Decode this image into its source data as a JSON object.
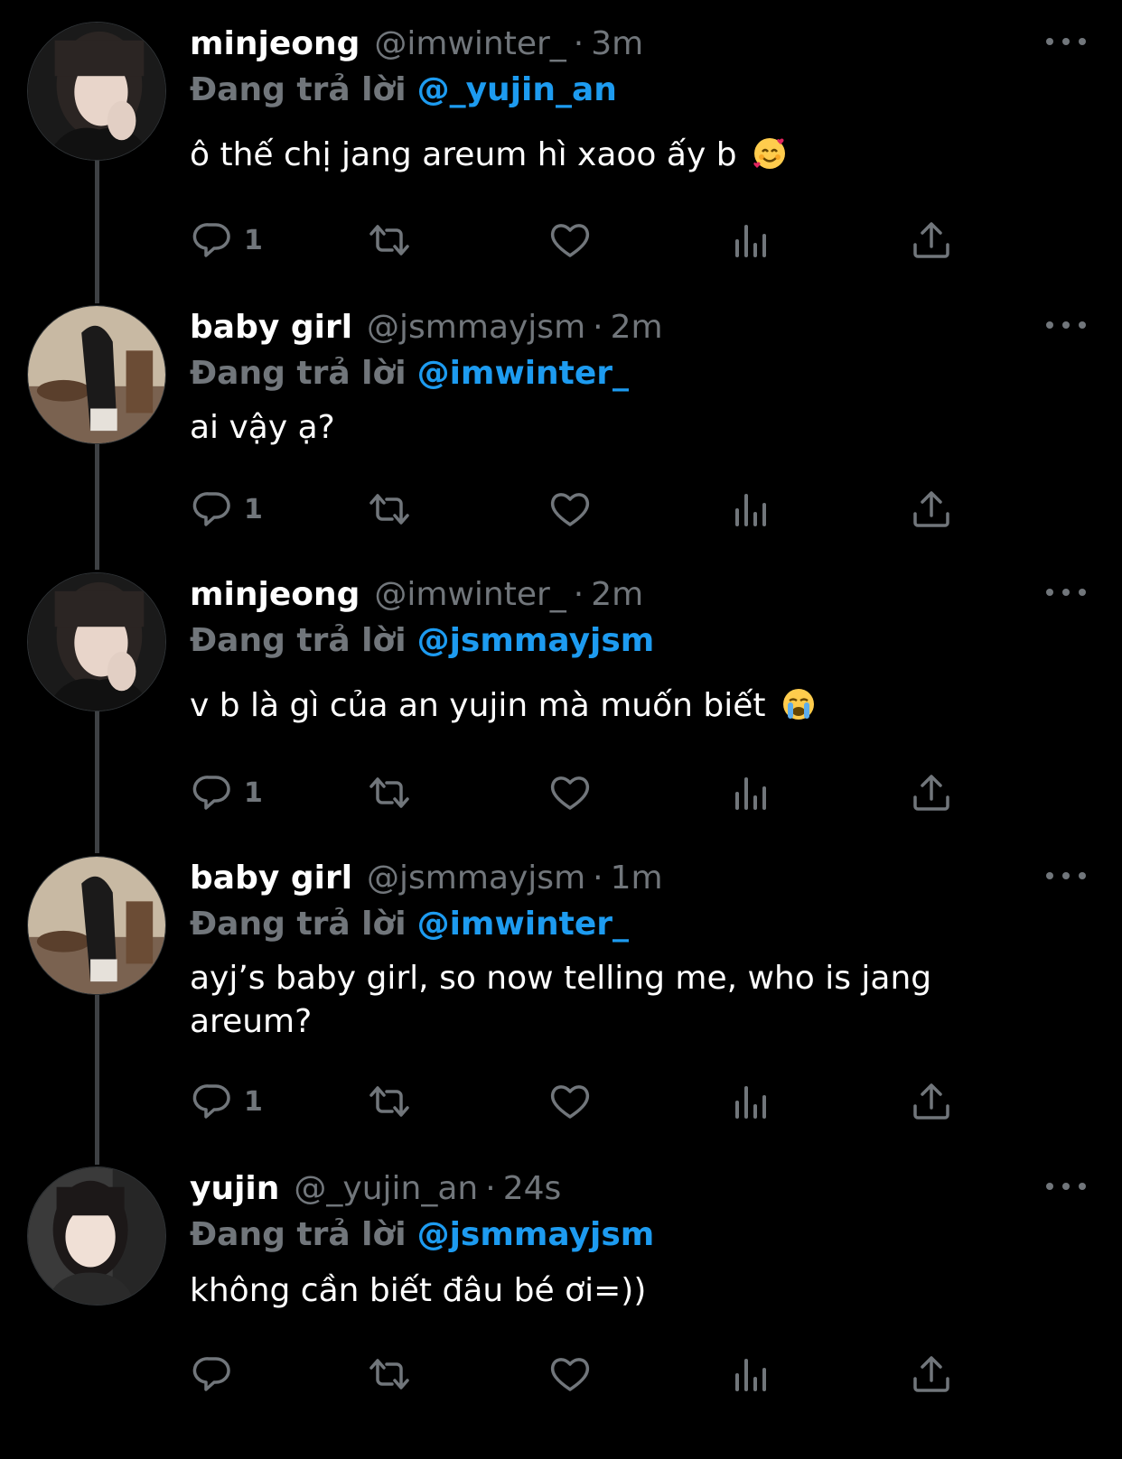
{
  "colors": {
    "background": "#000000",
    "name": "#ffffff",
    "muted": "#71767b",
    "link": "#1d9bf0",
    "thread_line": "#3e4144"
  },
  "icons": {
    "reply": "reply-icon",
    "retweet": "retweet-icon",
    "like": "heart-icon",
    "views": "views-icon",
    "share": "share-icon",
    "more": "more-icon"
  },
  "reply_prefix": "Đang trả lời",
  "tweets": [
    {
      "name": "minjeong",
      "handle": "@imwinter_",
      "separator": "·",
      "time": "3m",
      "reply_to": "@_yujin_an",
      "text": "ô thế chị jang areum hì xaoo ấy b",
      "emoji": "smiling-face-with-hearts",
      "reply_count": "1"
    },
    {
      "name": "baby girl",
      "handle": "@jsmmayjsm",
      "separator": "·",
      "time": "2m",
      "reply_to": "@imwinter_",
      "text": "ai vậy ạ?",
      "emoji": "",
      "reply_count": "1"
    },
    {
      "name": "minjeong",
      "handle": "@imwinter_",
      "separator": "·",
      "time": "2m",
      "reply_to": "@jsmmayjsm",
      "text": "v b là gì của an yujin mà muốn biết",
      "emoji": "loudly-crying-face",
      "reply_count": "1"
    },
    {
      "name": "baby girl",
      "handle": "@jsmmayjsm",
      "separator": "·",
      "time": "1m",
      "reply_to": "@imwinter_",
      "text": "ayj’s baby girl, so now telling me, who is jang areum?",
      "emoji": "",
      "reply_count": "1"
    },
    {
      "name": "yujin",
      "handle": "@_yujin_an",
      "separator": "·",
      "time": "24s",
      "reply_to": "@jsmmayjsm",
      "text": "không cần biết đâu bé ơi=))",
      "emoji": "",
      "reply_count": ""
    }
  ]
}
